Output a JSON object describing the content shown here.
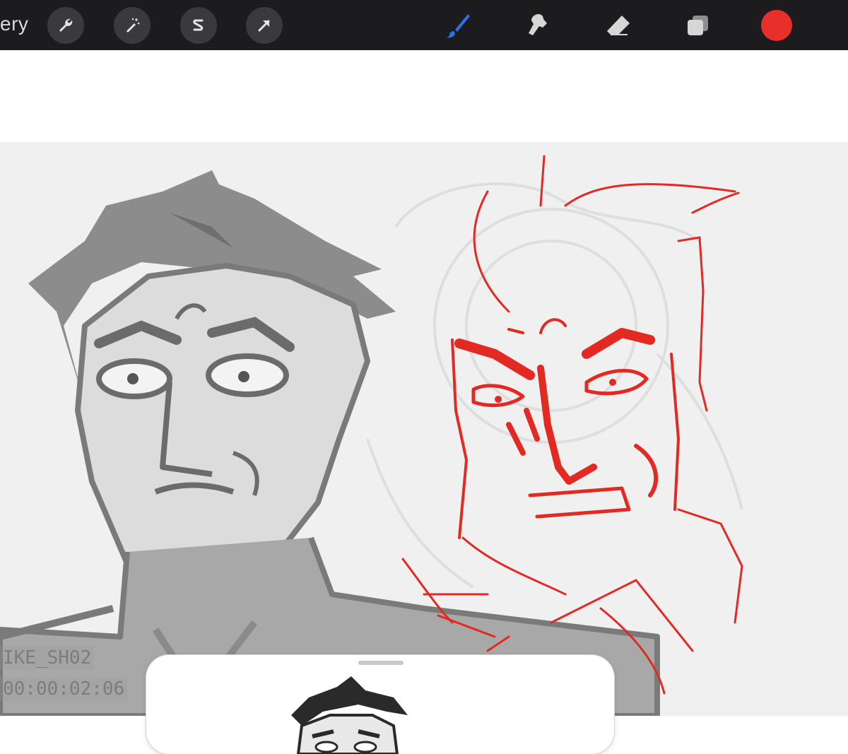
{
  "toolbar": {
    "gallery_label": "ery",
    "left_tools": [
      {
        "name": "wrench-icon"
      },
      {
        "name": "magic-wand-icon"
      },
      {
        "name": "selection-s-icon"
      },
      {
        "name": "transform-arrow-icon"
      }
    ],
    "right_tools": [
      {
        "name": "brush-icon",
        "active": true,
        "color": "#2f6ee8"
      },
      {
        "name": "smudge-icon"
      },
      {
        "name": "eraser-icon"
      },
      {
        "name": "layers-icon"
      }
    ],
    "current_color": "#e8302a"
  },
  "canvas": {
    "overlay_lines": [
      "IKE_SH02",
      "00:00:02:06"
    ]
  },
  "reference_panel": {
    "handle": "grabber"
  }
}
